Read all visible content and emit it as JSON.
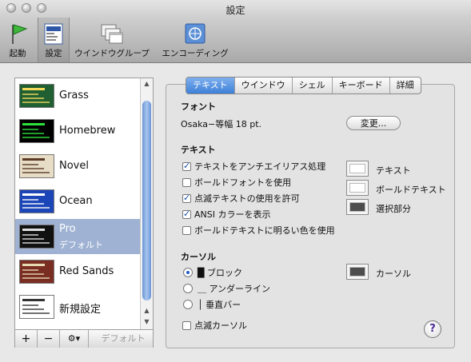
{
  "window": {
    "title": "設定"
  },
  "toolbar": {
    "items": [
      {
        "label": "起動",
        "icon": "green-flag-icon"
      },
      {
        "label": "設定",
        "icon": "settings-panel-icon"
      },
      {
        "label": "ウインドウグループ",
        "icon": "window-group-icon"
      },
      {
        "label": "エンコーディング",
        "icon": "un-globe-icon"
      }
    ]
  },
  "sidebar": {
    "items": [
      {
        "name": "Grass",
        "subtitle": "",
        "thumb_bg": "#1f5f32",
        "thumb_fg": "#f2d95a"
      },
      {
        "name": "Homebrew",
        "subtitle": "",
        "thumb_bg": "#000000",
        "thumb_fg": "#2ce23a"
      },
      {
        "name": "Novel",
        "subtitle": "",
        "thumb_bg": "#e7dcc5",
        "thumb_fg": "#5a3a25"
      },
      {
        "name": "Ocean",
        "subtitle": "",
        "thumb_bg": "#1c45b8",
        "thumb_fg": "#ffffff"
      },
      {
        "name": "Pro",
        "subtitle": "デフォルト",
        "thumb_bg": "#111111",
        "thumb_fg": "#dddddd",
        "selected": true
      },
      {
        "name": "Red Sands",
        "subtitle": "",
        "thumb_bg": "#7a2d22",
        "thumb_fg": "#e7d9b4"
      },
      {
        "name": "新規設定",
        "subtitle": "",
        "thumb_bg": "#ffffff",
        "thumb_fg": "#333333"
      }
    ],
    "add_label": "+",
    "remove_label": "−",
    "gear_label": "⚙▾",
    "default_label": "デフォルト"
  },
  "tabs": [
    "テキスト",
    "ウインドウ",
    "シェル",
    "キーボード",
    "詳細"
  ],
  "font": {
    "heading": "フォント",
    "value": "Osaka−等幅 18 pt.",
    "change_label": "変更..."
  },
  "text": {
    "heading": "テキスト",
    "options": [
      {
        "label": "テキストをアンチエイリアス処理",
        "checked": true
      },
      {
        "label": "ボールドフォントを使用",
        "checked": false
      },
      {
        "label": "点滅テキストの使用を許可",
        "checked": true
      },
      {
        "label": "ANSI カラーを表示",
        "checked": true
      },
      {
        "label": "ボールドテキストに明るい色を使用",
        "checked": false
      }
    ],
    "colors": [
      {
        "label": "テキスト",
        "color": "#ffffff"
      },
      {
        "label": "ボールドテキスト",
        "color": "#ffffff"
      },
      {
        "label": "選択部分",
        "color": "#4d4d4d"
      }
    ]
  },
  "cursor": {
    "heading": "カーソル",
    "styles": [
      {
        "label": "█ ブロック",
        "selected": true
      },
      {
        "label": "＿ アンダーライン",
        "selected": false
      },
      {
        "label": "│ 垂直バー",
        "selected": false
      }
    ],
    "blink_label": "点滅カーソル",
    "blink_checked": false,
    "color_label": "カーソル",
    "color": "#4d4d4d"
  },
  "help_label": "?"
}
